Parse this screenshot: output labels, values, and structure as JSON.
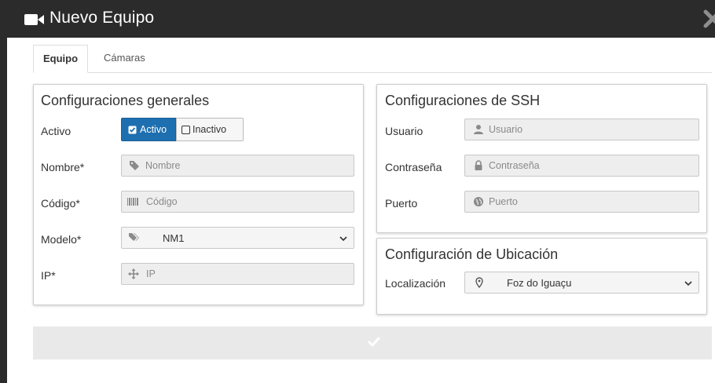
{
  "dialog": {
    "title": "Nuevo Equipo",
    "title_icon": "video-camera-icon",
    "close_icon": "close-icon"
  },
  "tabs": [
    {
      "label": "Equipo",
      "active": true
    },
    {
      "label": "Cámaras",
      "active": false
    }
  ],
  "general": {
    "title": "Configuraciones generales",
    "activo_label": "Activo",
    "toggle": {
      "on_label": "Activo",
      "off_label": "Inactivo",
      "selected": "Activo"
    },
    "nombre": {
      "label": "Nombre*",
      "placeholder": "Nombre",
      "value": "",
      "icon": "tag-icon"
    },
    "codigo": {
      "label": "Código*",
      "placeholder": "Código",
      "value": "",
      "icon": "barcode-icon"
    },
    "modelo": {
      "label": "Modelo*",
      "selected": "NM1",
      "icon": "tags-icon"
    },
    "ip": {
      "label": "IP*",
      "placeholder": "IP",
      "value": "",
      "icon": "arrows-icon"
    }
  },
  "ssh": {
    "title": "Configuraciones de SSH",
    "usuario": {
      "label": "Usuario",
      "placeholder": "Usuario",
      "value": "",
      "icon": "user-icon"
    },
    "contrasena": {
      "label": "Contraseña",
      "placeholder": "Contraseña",
      "value": "",
      "icon": "lock-icon"
    },
    "puerto": {
      "label": "Puerto",
      "placeholder": "Puerto",
      "value": "",
      "icon": "globe-icon"
    }
  },
  "ubicacion": {
    "title": "Configuración de Ubicación",
    "localizacion": {
      "label": "Localización",
      "selected": "Foz do Iguaçu",
      "icon": "map-marker-icon"
    }
  },
  "submit": {
    "icon": "check-icon"
  },
  "colors": {
    "titlebar": "#2b2b2b",
    "toggle_active": "#1e6fb0",
    "field_bg": "#eeeeee",
    "submit_bg": "#e9e9e9"
  }
}
